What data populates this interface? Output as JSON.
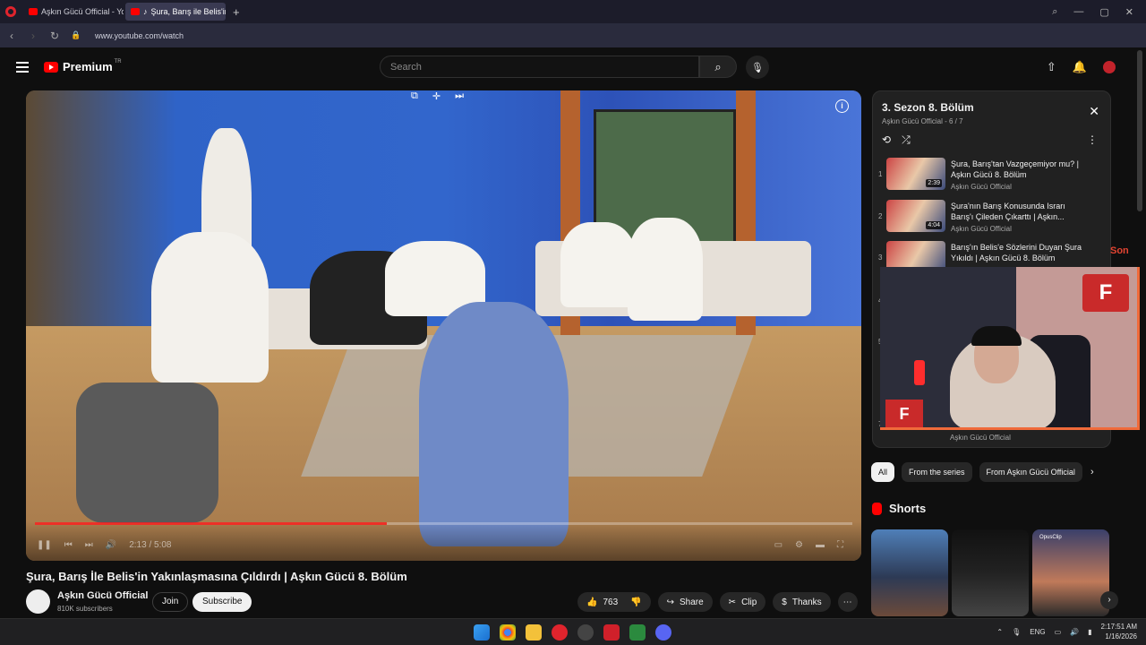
{
  "browser": {
    "tabs": [
      {
        "label": "Aşkın Gücü Official - YouT",
        "active": false
      },
      {
        "label": "Şura, Barış ile Belis'in",
        "active": true
      }
    ],
    "url": "www.youtube.com/watch",
    "ai_label": "AI"
  },
  "header": {
    "logo_text": "Premium",
    "region": "TR",
    "search_placeholder": "Search"
  },
  "video": {
    "time": "2:13 / 5:08",
    "progress_fraction": 0.43,
    "title": "Şura, Barış İle Belis'in Yakınlaşmasına Çıldırdı | Aşkın Gücü 8. Bölüm",
    "channel": "Aşkın Gücü Official",
    "subscribers": "810K subscribers",
    "join_label": "Join",
    "subscribe_label": "Subscribe",
    "likes": "763",
    "share_label": "Share",
    "clip_label": "Clip",
    "thanks_label": "Thanks"
  },
  "playlist": {
    "title": "3. Sezon 8. Bölüm",
    "channel": "Aşkın Gücü Official",
    "position": "- 6 / 7",
    "items": [
      {
        "num": "1",
        "title": "Şura, Barış'tan Vazgeçemiyor mu? | Aşkın Gücü 8. Bölüm",
        "duration": "2:39",
        "channel": "Aşkın Gücü Official"
      },
      {
        "num": "2",
        "title": "Şura'nın Barış Konusunda Israrı Barış'ı Çileden Çıkarttı | Aşkın...",
        "duration": "4:04",
        "channel": "Aşkın Gücü Official"
      },
      {
        "num": "3",
        "title": "Barış'ın Belis'e Sözlerini Duyan Şura Yıkıldı | Aşkın Gücü 8. Bölüm",
        "duration": "",
        "channel": ""
      }
    ],
    "last_item_channel": "Aşkın Gücü Official",
    "hidden_nums": [
      "4",
      "5",
      "7"
    ]
  },
  "webcam": {
    "overlay_text": "Son",
    "logo_text": "F"
  },
  "chips": [
    "All",
    "From the series",
    "From Aşkın Gücü Official"
  ],
  "shorts": {
    "heading": "Shorts",
    "watermark": "OpusClip"
  },
  "taskbar": {
    "lang": "ENG",
    "time": "2:17:51 AM",
    "date": "1/16/2026"
  },
  "colors": {
    "accent": "#ff0000",
    "bg": "#0f0f0f",
    "webcam_border": "#f06a3a"
  }
}
